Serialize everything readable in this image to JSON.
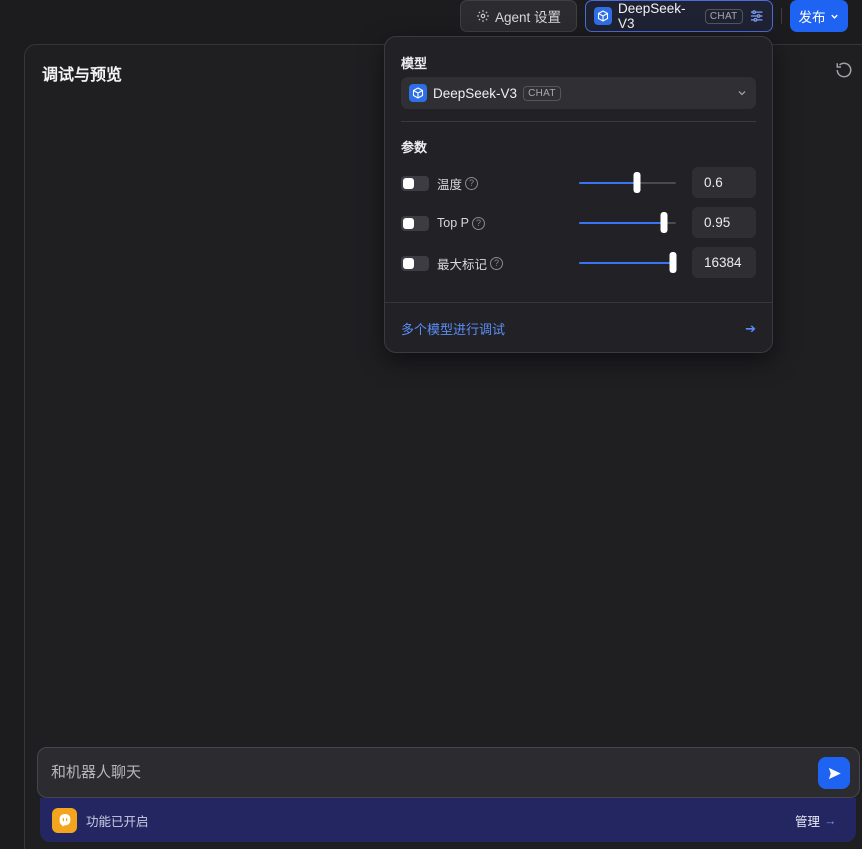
{
  "topbar": {
    "agent_settings_label": "Agent 设置",
    "model_name": "DeepSeek-V3",
    "model_tag": "CHAT",
    "publish_label": "发布"
  },
  "panel": {
    "title": "调试与预览"
  },
  "model_popover": {
    "model_section_label": "模型",
    "selected_model": "DeepSeek-V3",
    "selected_model_tag": "CHAT",
    "params_section_label": "参数",
    "params": [
      {
        "name": "温度",
        "value": "0.6",
        "fill_fraction": 0.6,
        "enabled": false
      },
      {
        "name": "Top P",
        "value": "0.95",
        "fill_fraction": 0.88,
        "enabled": false
      },
      {
        "name": "最大标记",
        "value": "16384",
        "fill_fraction": 1.0,
        "enabled": false
      }
    ],
    "multi_model_link": "多个模型进行调试"
  },
  "chat": {
    "input_placeholder": "和机器人聊天",
    "feature_status": "功能已开启",
    "manage_label": "管理"
  },
  "colors": {
    "accent": "#1f63f2",
    "link": "#5b8cf6",
    "feature_bar": "#232660",
    "feature_icon": "#f3a51d"
  }
}
